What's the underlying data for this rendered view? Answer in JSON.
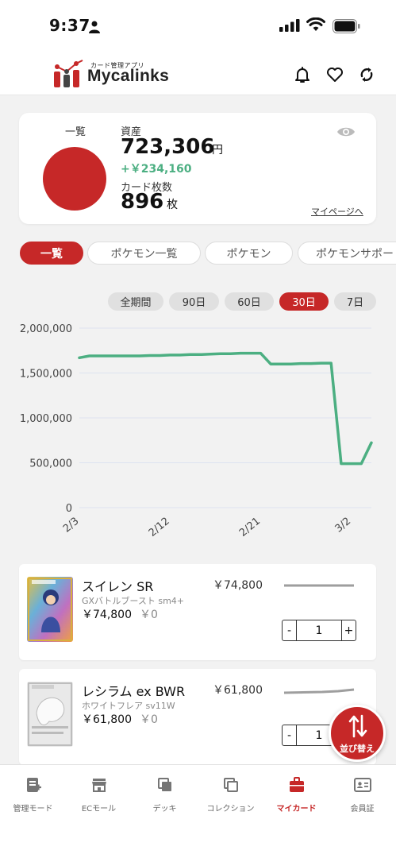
{
  "status_bar": {
    "time": "9:37"
  },
  "header": {
    "logo_subtitle": "カード管理アプリ",
    "logo_text": "Mycalinks"
  },
  "summary": {
    "breakdown_label": "一覧",
    "asset_label": "資産",
    "asset_value": "723,306",
    "asset_unit": "円",
    "asset_delta": "+￥234,160",
    "card_count_label": "カード枚数",
    "card_count_value": "896",
    "card_count_unit": "枚",
    "mypage_link": "マイページへ",
    "accent_color": "#c62828",
    "positive_color": "#4caf82"
  },
  "category_tabs": [
    "一覧",
    "ポケモン一覧",
    "ポケモン",
    "ポケモンサポー"
  ],
  "category_active": "一覧",
  "range_tabs": [
    "全期間",
    "90日",
    "60日",
    "30日",
    "7日"
  ],
  "range_active": "30日",
  "chart_data": {
    "type": "line",
    "x": [
      "2/3",
      "2/4",
      "2/5",
      "2/6",
      "2/7",
      "2/8",
      "2/9",
      "2/10",
      "2/11",
      "2/12",
      "2/13",
      "2/14",
      "2/15",
      "2/16",
      "2/17",
      "2/18",
      "2/19",
      "2/20",
      "2/21",
      "2/22",
      "2/23",
      "2/24",
      "2/25",
      "2/26",
      "2/27",
      "2/28",
      "3/1",
      "3/2",
      "3/3",
      "3/4"
    ],
    "xticks": [
      "2/3",
      "2/12",
      "2/21",
      "3/2"
    ],
    "yticks": [
      "2,000,000",
      "1,500,000",
      "1,000,000",
      "500,000",
      "0"
    ],
    "ylim": [
      0,
      2000000
    ],
    "grid": true,
    "series": [
      {
        "color": "#4caf82",
        "values": [
          1670000,
          1690000,
          1690000,
          1690000,
          1690000,
          1690000,
          1690000,
          1695000,
          1695000,
          1700000,
          1700000,
          1705000,
          1705000,
          1710000,
          1715000,
          1715000,
          1720000,
          1720000,
          1720000,
          1600000,
          1600000,
          1600000,
          1605000,
          1605000,
          1610000,
          1610000,
          490000,
          490000,
          490000,
          723306
        ]
      }
    ]
  },
  "cards": [
    {
      "name": "スイレン SR",
      "set": "GXバトルブースト sm4+",
      "price_header": "￥74,800",
      "price": "￥74,800",
      "change": "￥0",
      "quantity": "1",
      "minus": "-",
      "plus": "+"
    },
    {
      "name": "レシラム ex BWR",
      "set": "ホワイトフレア sv11W",
      "price_header": "￥61,800",
      "price": "￥61,800",
      "change": "￥0",
      "quantity": "1",
      "minus": "-",
      "plus": "+"
    }
  ],
  "fab": {
    "label": "並び替え"
  },
  "bottom_nav": [
    {
      "label": "管理モード",
      "icon": "edit-note-icon"
    },
    {
      "label": "ECモール",
      "icon": "store-icon"
    },
    {
      "label": "デッキ",
      "icon": "deck-icon"
    },
    {
      "label": "コレクション",
      "icon": "collection-icon"
    },
    {
      "label": "マイカード",
      "icon": "briefcase-icon",
      "active": true
    },
    {
      "label": "会員証",
      "icon": "member-card-icon"
    }
  ]
}
